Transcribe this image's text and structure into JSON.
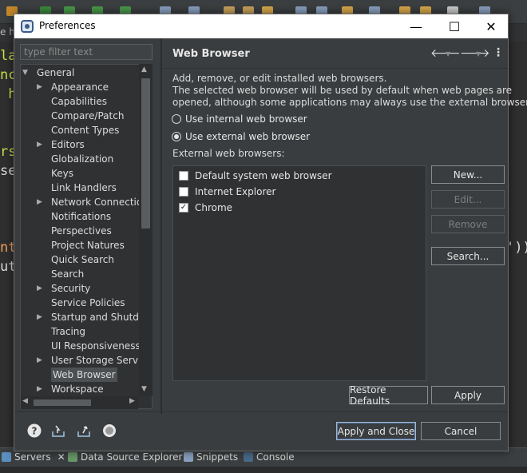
{
  "ide": {
    "tab_text": "e h",
    "code_lines": [
      {
        "text": "la",
        "color": "#cbe24c"
      },
      {
        "text": "nc",
        "color": "#cbe24c"
      },
      {
        "text": " h",
        "color": "#cbe24c"
      },
      {
        "text": "rs",
        "color": "#cbe24c"
      },
      {
        "text": "se",
        "color": "#dcdcdc"
      },
      {
        "text": "nt",
        "color": "#f4a261"
      },
      {
        "text": "ut",
        "color": "#dcdcdc"
      },
      {
        "text": "'))",
        "color": "#dcdcdc"
      }
    ],
    "bottom_tabs": [
      {
        "label": "Servers"
      },
      {
        "label": "Data Source Explorer"
      },
      {
        "label": "Snippets"
      },
      {
        "label": "Console"
      }
    ]
  },
  "dialog": {
    "title": "Preferences",
    "filter_placeholder": "type filter text",
    "tree": [
      {
        "label": "General",
        "chevron": "down"
      },
      {
        "label": "Appearance",
        "chevron": "right"
      },
      {
        "label": "Capabilities",
        "chevron": ""
      },
      {
        "label": "Compare/Patch",
        "chevron": ""
      },
      {
        "label": "Content Types",
        "chevron": ""
      },
      {
        "label": "Editors",
        "chevron": "right"
      },
      {
        "label": "Globalization",
        "chevron": ""
      },
      {
        "label": "Keys",
        "chevron": ""
      },
      {
        "label": "Link Handlers",
        "chevron": ""
      },
      {
        "label": "Network Connection",
        "chevron": "right"
      },
      {
        "label": "Notifications",
        "chevron": ""
      },
      {
        "label": "Perspectives",
        "chevron": ""
      },
      {
        "label": "Project Natures",
        "chevron": ""
      },
      {
        "label": "Quick Search",
        "chevron": ""
      },
      {
        "label": "Search",
        "chevron": ""
      },
      {
        "label": "Security",
        "chevron": "right"
      },
      {
        "label": "Service Policies",
        "chevron": ""
      },
      {
        "label": "Startup and Shutdow",
        "chevron": "right"
      },
      {
        "label": "Tracing",
        "chevron": ""
      },
      {
        "label": "UI Responsiveness M",
        "chevron": ""
      },
      {
        "label": "User Storage Service",
        "chevron": "right"
      },
      {
        "label": "Web Browser",
        "chevron": "",
        "selected": true
      },
      {
        "label": "Workspace",
        "chevron": "right"
      }
    ],
    "page": {
      "title": "Web Browser",
      "description_lines": [
        "Add, remove, or edit installed web browsers.",
        "The selected web browser will be used by default when web pages are",
        "opened, although some applications may always use the external browser."
      ],
      "radio_internal": "Use internal web browser",
      "radio_external": "Use external web browser",
      "radio_selected": "external",
      "list_label": "External web browsers:",
      "browsers": [
        {
          "name": "Default system web browser",
          "checked": false
        },
        {
          "name": "Internet Explorer",
          "checked": false
        },
        {
          "name": "Chrome",
          "checked": true
        }
      ],
      "buttons": {
        "new": "New...",
        "edit": "Edit...",
        "remove": "Remove",
        "search": "Search..."
      },
      "restore_defaults": "Restore Defaults",
      "apply": "Apply"
    },
    "footer": {
      "apply_close": "Apply and Close",
      "cancel": "Cancel"
    }
  },
  "colors": {
    "dialog_bg": "#3a3d3f",
    "selection": "#4c5052"
  }
}
